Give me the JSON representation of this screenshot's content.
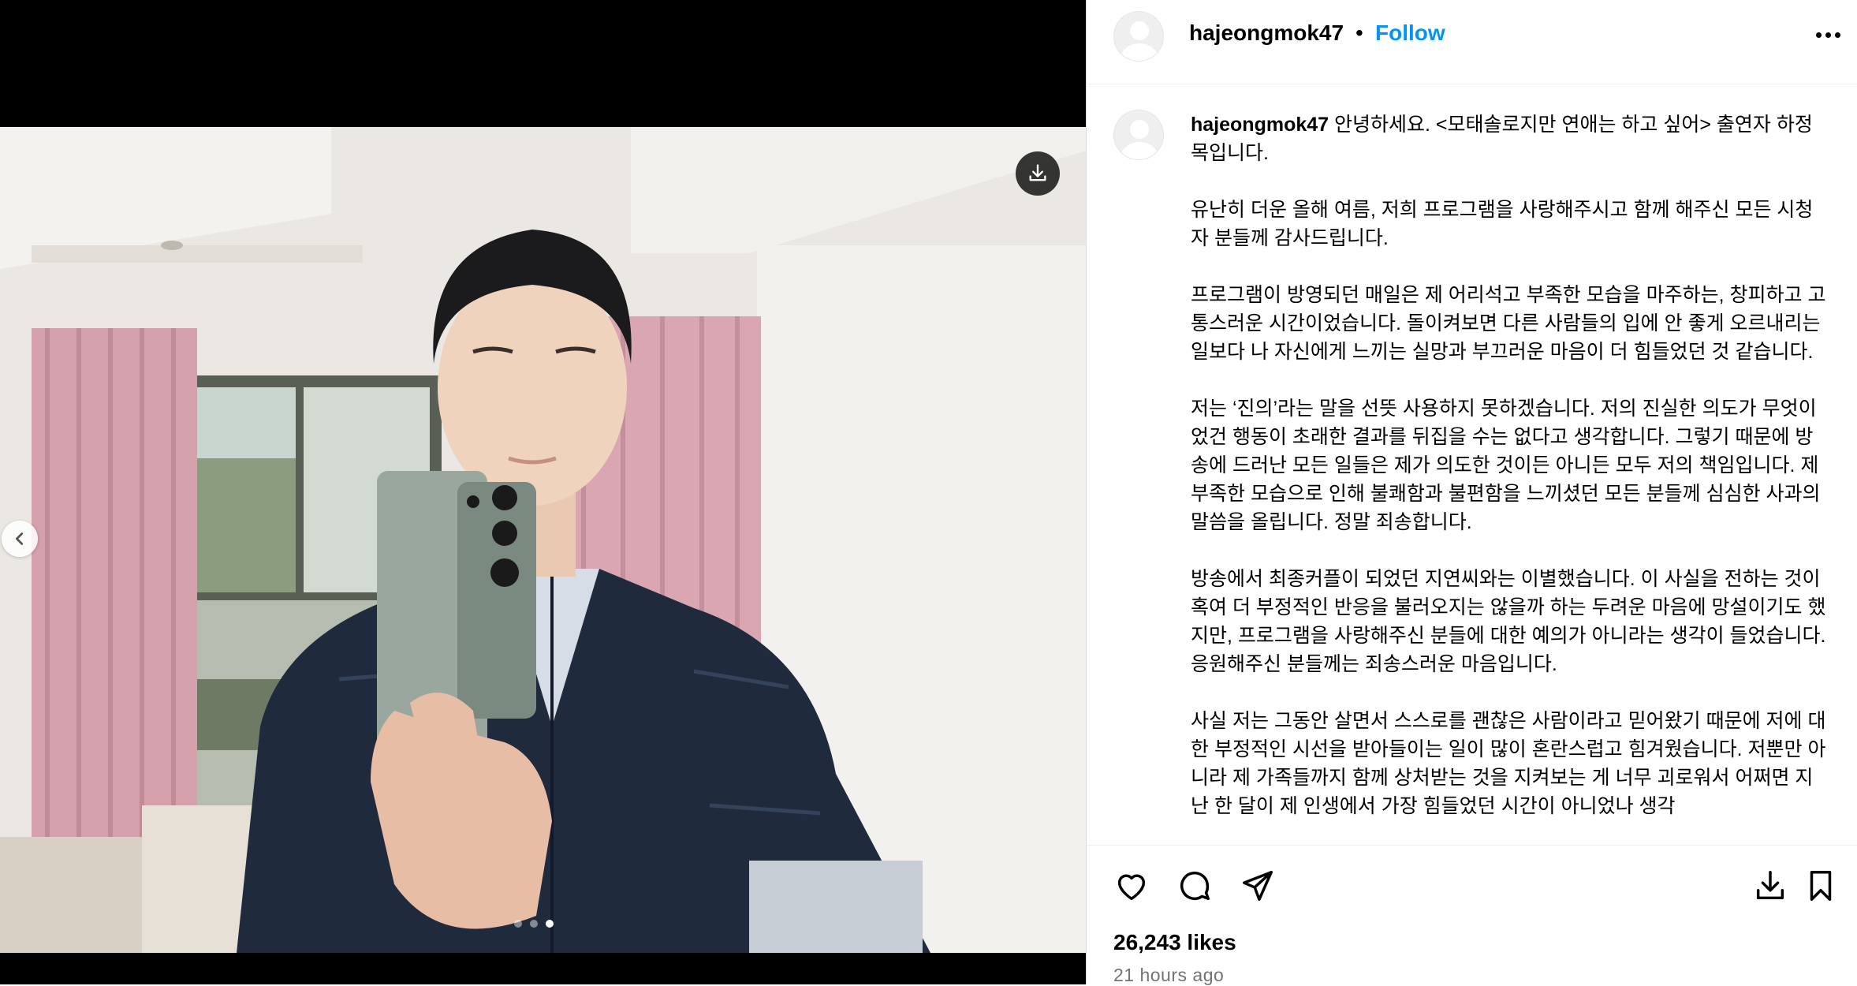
{
  "post": {
    "username": "hajeongmok47",
    "separator": "•",
    "follow_label": "Follow",
    "more_icon": "more-horizontal-icon",
    "caption_paragraphs": [
      "안녕하세요. <모태솔로지만 연애는 하고 싶어> 출연자 하정목입니다.",
      "유난히 더운 올해 여름, 저희 프로그램을 사랑해주시고 함께 해주신 모든 시청자 분들께 감사드립니다.",
      "프로그램이 방영되던 매일은 제 어리석고 부족한 모습을 마주하는, 창피하고 고통스러운 시간이었습니다. 돌이켜보면 다른 사람들의 입에 안 좋게 오르내리는 일보다 나 자신에게 느끼는 실망과 부끄러운 마음이 더 힘들었던 것 같습니다.",
      "저는 ‘진의’라는 말을 선뜻 사용하지 못하겠습니다. 저의 진실한 의도가 무엇이었건 행동이 초래한 결과를 뒤집을 수는 없다고 생각합니다. 그렇기 때문에 방송에 드러난 모든 일들은 제가 의도한 것이든 아니든 모두 저의 책임입니다. 제 부족한 모습으로 인해 불쾌함과 불편함을 느끼셨던 모든 분들께 심심한 사과의 말씀을 올립니다. 정말 죄송합니다.",
      "방송에서 최종커플이 되었던 지연씨와는 이별했습니다. 이 사실을 전하는 것이 혹여 더 부정적인 반응을 불러오지는 않을까 하는 두려운 마음에 망설이기도 했지만, 프로그램을 사랑해주신 분들에 대한 예의가 아니라는 생각이 들었습니다. 응원해주신 분들께는 죄송스러운 마음입니다.",
      "사실 저는 그동안 살면서 스스로를 괜찮은 사람이라고 믿어왔기 때문에 저에 대한 부정적인 시선을 받아들이는 일이 많이 혼란스럽고 힘겨웠습니다. 저뿐만 아니라 제 가족들까지 함께 상처받는 것을 지켜보는 게 너무 괴로워서 어쩌면 지난 한 달이 제 인생에서 가장 힘들었던 시간이 아니었나 생각"
    ],
    "likes": "26,243 likes",
    "time": "21 hours ago"
  },
  "media": {
    "slide_count": 3,
    "active_slide": 3,
    "download_icon": "download-icon",
    "prev_icon": "chevron-left-icon"
  },
  "actions": {
    "like_icon": "heart-icon",
    "comment_icon": "comment-icon",
    "share_icon": "send-icon",
    "save_to_icon": "download-icon",
    "bookmark_icon": "bookmark-icon"
  },
  "colors": {
    "accent": "#0095f6",
    "muted": "#737373"
  }
}
